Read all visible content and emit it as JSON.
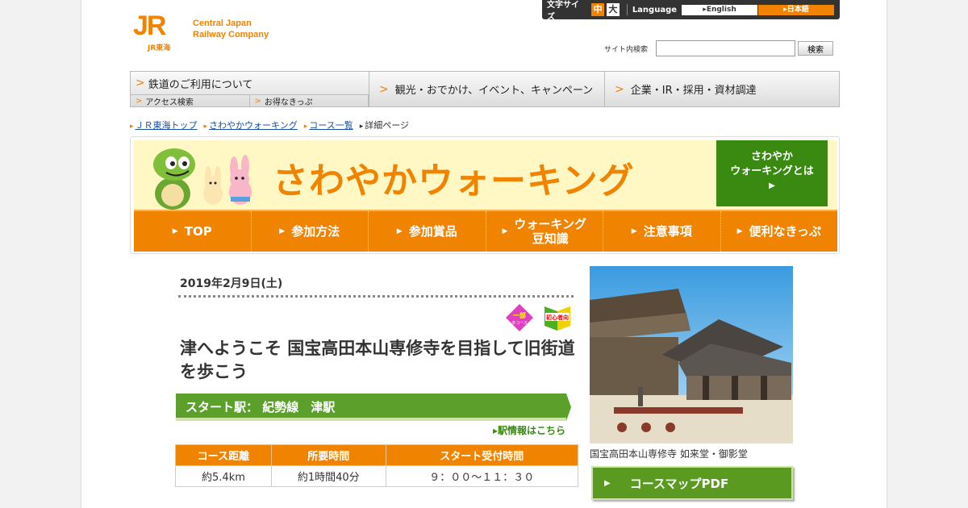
{
  "header": {
    "logo_mark": "JR",
    "logo_sub": "JR東海",
    "company_line1": "Central Japan",
    "company_line2": "Railway Company",
    "font_size_label": "文字サイズ",
    "font_mid": "中",
    "font_big": "大",
    "language_label": "Language",
    "lang_en": "English",
    "lang_jp": "日本語",
    "search_label": "サイト内検索",
    "search_value": "",
    "search_button": "検索"
  },
  "gnav": {
    "item1": "鉄道のご利用について",
    "sub1": "アクセス検索",
    "sub2": "お得なきっぷ",
    "item2": "観光・おでかけ、イベント、キャンペーン",
    "item3": "企業・IR・採用・資材調達"
  },
  "breadcrumb": [
    "ＪＲ東海トップ",
    "さわやかウォーキング",
    "コース一覧",
    "詳細ページ"
  ],
  "banner": {
    "title": "さわやかウォーキング",
    "about_line1": "さわやか",
    "about_line2": "ウォーキングとは",
    "nav": [
      {
        "label": "TOP"
      },
      {
        "label": "参加方法"
      },
      {
        "label": "参加賞品"
      },
      {
        "label": "ウォーキング豆知識",
        "line1": "ウォーキング",
        "line2": "豆知識"
      },
      {
        "label": "注意事項"
      },
      {
        "label": "便利なきっぷ"
      }
    ]
  },
  "course": {
    "date": "2019年2月9日(土)",
    "badge1": "一部",
    "badge1_sub": "歩コース",
    "badge2": "初心者向",
    "title": "津へようこそ 国宝高田本山専修寺を目指して旧街道を歩こう",
    "start_label": "スタート駅：",
    "start_value": "紀勢線　津駅",
    "station_info": "駅情報はこちら",
    "table_headers": [
      "コース距離",
      "所要時間",
      "スタート受付時間"
    ],
    "table_values": [
      "約5.4km",
      "約1時間40分",
      "９：００～１１：３０"
    ],
    "photo_caption": "国宝高田本山専修寺 如来堂・御影堂",
    "map_button": "コースマップPDF"
  },
  "colors": {
    "accent": "#f08300",
    "green": "#3a8a12",
    "link": "#1a4fa0"
  }
}
